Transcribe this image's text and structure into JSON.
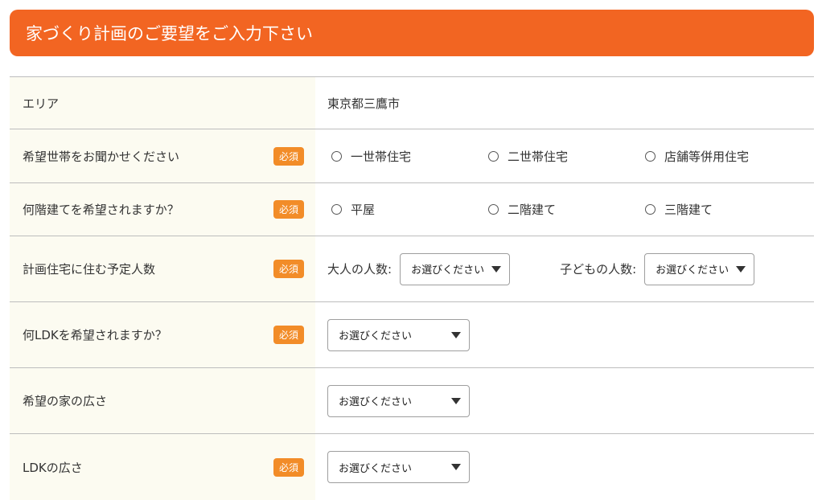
{
  "header": {
    "title": "家づくり計画のご要望をご入力下さい"
  },
  "required_badge": "必須",
  "rows": {
    "area": {
      "label": "エリア",
      "value": "東京都三鷹市"
    },
    "household": {
      "label": "希望世帯をお聞かせください",
      "options": [
        "一世帯住宅",
        "二世帯住宅",
        "店舗等併用住宅"
      ]
    },
    "floors": {
      "label": "何階建てを希望されますか？",
      "options": [
        "平屋",
        "二階建て",
        "三階建て"
      ]
    },
    "people": {
      "label": "計画住宅に住む予定人数",
      "adults_label": "大人の人数:",
      "adults_value": "お選びください",
      "children_label": "子どもの人数:",
      "children_value": "お選びください"
    },
    "ldk_type": {
      "label": "何LDKを希望されますか？",
      "value": "お選びください"
    },
    "house_size": {
      "label": "希望の家の広さ",
      "value": "お選びください"
    },
    "ldk_size": {
      "label": "LDKの広さ",
      "value": "お選びください"
    }
  }
}
